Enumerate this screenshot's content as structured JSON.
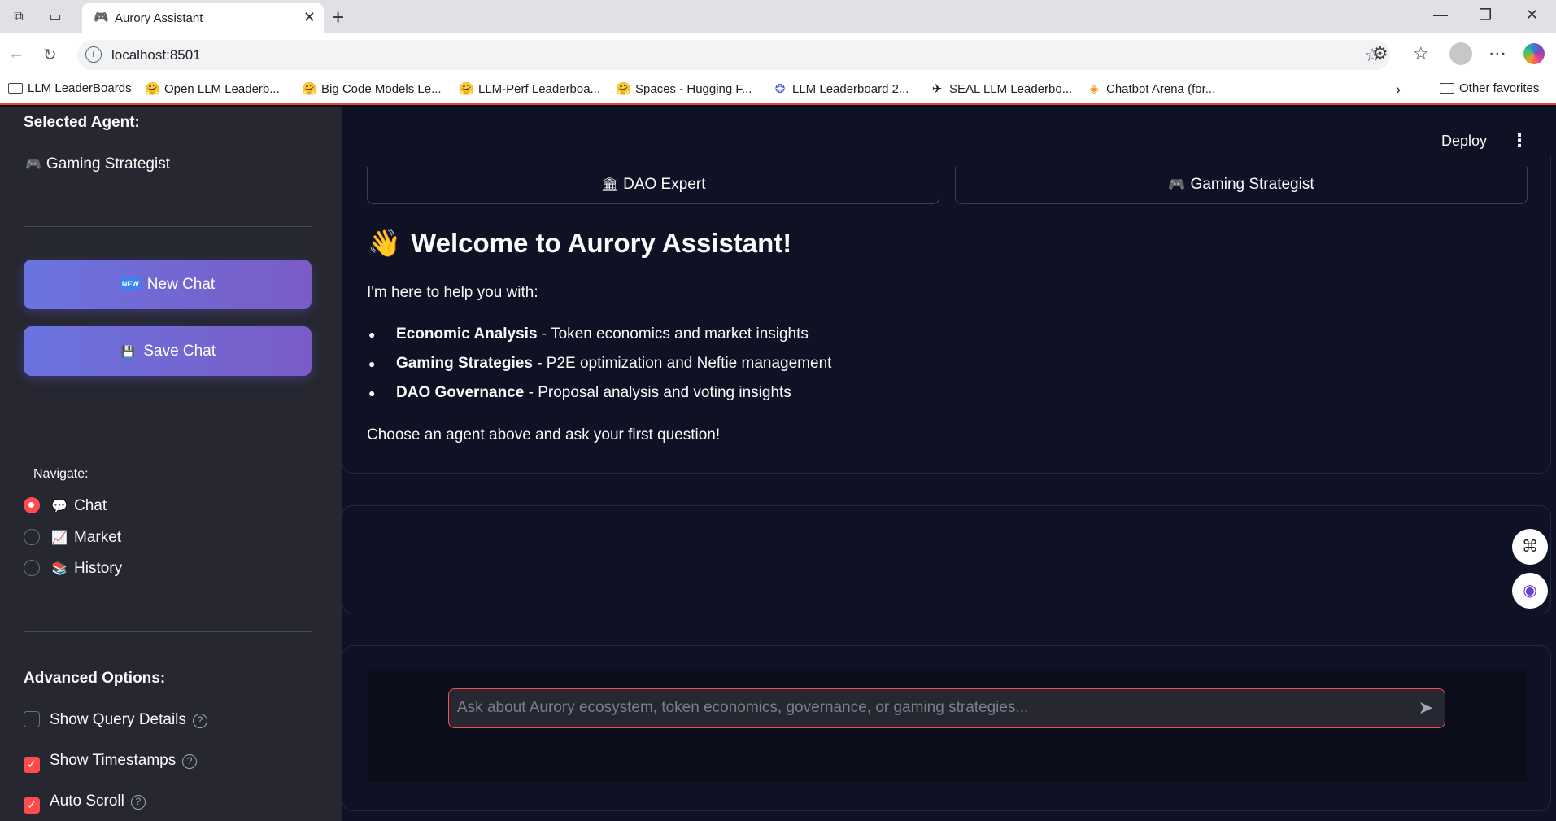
{
  "browser": {
    "tab_title": "Aurory Assistant",
    "url": "localhost:8501",
    "bookmarks": [
      {
        "label": "LLM LeaderBoards",
        "icon": "folder-icon"
      },
      {
        "label": "Open LLM Leaderb...",
        "icon": "hugging-face-icon"
      },
      {
        "label": "Big Code Models Le...",
        "icon": "hugging-face-icon"
      },
      {
        "label": "LLM-Perf Leaderboa...",
        "icon": "hugging-face-icon"
      },
      {
        "label": "Spaces - Hugging F...",
        "icon": "hugging-face-icon"
      },
      {
        "label": "LLM Leaderboard 2...",
        "icon": "leaderboard-icon"
      },
      {
        "label": "SEAL LLM Leaderbo...",
        "icon": "seal-icon"
      },
      {
        "label": "Chatbot Arena (for...",
        "icon": "arena-icon"
      }
    ],
    "other_favorites": "Other favorites"
  },
  "sidebar": {
    "selected_agent_label": "Selected Agent:",
    "selected_agent": "Gaming Strategist",
    "selected_agent_icon": "🎮",
    "new_chat": "New Chat",
    "new_chat_icon": "NEW",
    "save_chat": "Save Chat",
    "save_chat_icon": "💾",
    "navigate_label": "Navigate:",
    "nav_options": [
      {
        "label": "Chat",
        "icon": "💬",
        "selected": true
      },
      {
        "label": "Market",
        "icon": "📈",
        "selected": false
      },
      {
        "label": "History",
        "icon": "📚",
        "selected": false
      }
    ],
    "advanced_label": "Advanced Options:",
    "options": [
      {
        "label": "Show Query Details",
        "checked": false
      },
      {
        "label": "Show Timestamps",
        "checked": true
      },
      {
        "label": "Auto Scroll",
        "checked": true
      }
    ]
  },
  "header": {
    "deploy": "Deploy",
    "menu_icon": "⋮"
  },
  "main": {
    "agents": [
      {
        "label": "DAO Expert",
        "icon": "🏛"
      },
      {
        "label": "Gaming Strategist",
        "icon": "🎮"
      }
    ],
    "welcome_title": "Welcome to Aurory Assistant!",
    "welcome_icon": "👋",
    "intro": "I'm here to help you with:",
    "features": [
      {
        "title": "Economic Analysis",
        "desc": " - Token economics and market insights"
      },
      {
        "title": "Gaming Strategies",
        "desc": " - P2E optimization and Neftie management"
      },
      {
        "title": "DAO Governance",
        "desc": " - Proposal analysis and voting insights"
      }
    ],
    "outro": "Choose an agent above and ask your first question!",
    "chat_placeholder": "Ask about Aurory ecosystem, token economics, governance, or gaming strategies..."
  },
  "colors": {
    "accent": "#ff4b4b",
    "sidebar_bg": "#262730",
    "main_bg": "#0f1224",
    "button_gradient_start": "#6a74e0",
    "button_gradient_end": "#7b5cc6"
  }
}
